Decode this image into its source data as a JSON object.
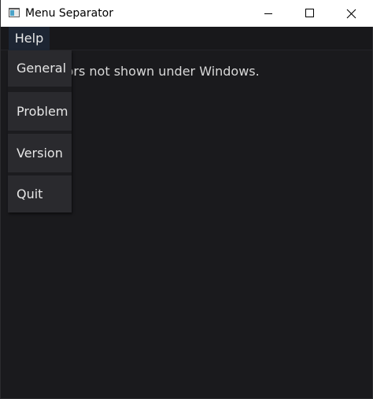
{
  "window": {
    "title": "Menu Separator",
    "icon": "app-window-icon"
  },
  "title_controls": {
    "minimize": "minimize-icon",
    "maximize": "maximize-icon",
    "close": "close-icon"
  },
  "menubar": {
    "items": [
      {
        "label": "Help",
        "active": true
      }
    ]
  },
  "help_menu": {
    "items": [
      {
        "label": "General"
      },
      {
        "label": "Problem"
      },
      {
        "label": "Version"
      },
      {
        "label": "Quit"
      }
    ]
  },
  "main": {
    "message": "Separators not shown under Windows."
  },
  "colors": {
    "window_bg": "#1a1a1d",
    "menu_item_bg": "#2a2a2e",
    "active_menu_bg": "#1d2533",
    "text": "#e6e6e6"
  }
}
